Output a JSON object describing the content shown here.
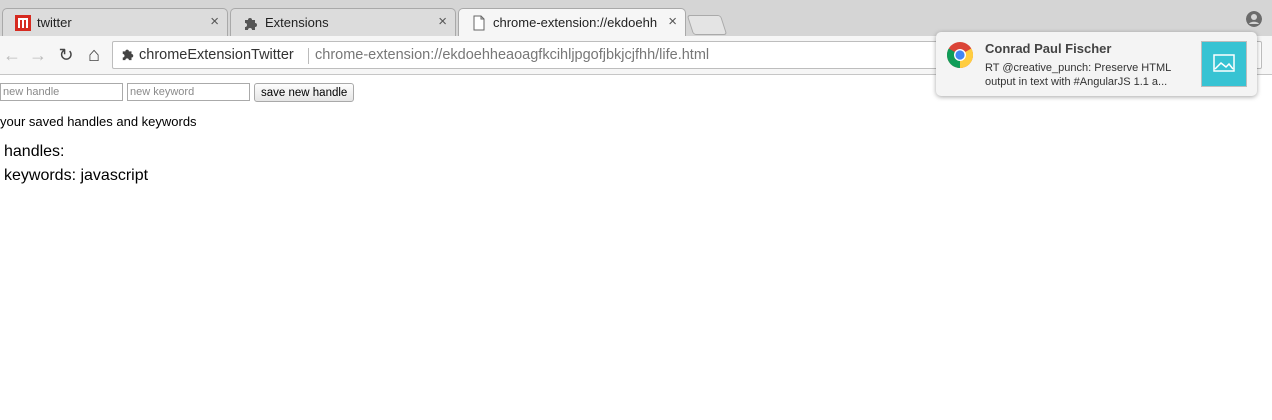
{
  "browser": {
    "tabs": [
      {
        "title": "twitter",
        "close": "×"
      },
      {
        "title": "Extensions",
        "close": "×"
      },
      {
        "title": "chrome-extension://ekdoehh",
        "close": "×"
      }
    ],
    "omnibox": {
      "extension_name": "chromeExtensionTwitter",
      "url": "chrome-extension://ekdoehheaoagfkcihljpgofjbkjcjfhh/life.html"
    },
    "nav": {
      "back": "←",
      "forward": "→",
      "reload": "↻",
      "home": "⌂"
    }
  },
  "page": {
    "handle_placeholder": "new handle",
    "keyword_placeholder": "new keyword",
    "save_label": "save new handle",
    "saved_text": "your saved handles and keywords",
    "handles_line": "handles:",
    "keywords_line": "keywords: javascript"
  },
  "notification": {
    "title": "Conrad Paul Fischer",
    "body": "RT @creative_punch: Preserve HTML output in text with #AngularJS 1.1 a..."
  },
  "colors": {
    "accent_thumb": "#37c3d3",
    "twitter_favicon": "#d62a20"
  }
}
